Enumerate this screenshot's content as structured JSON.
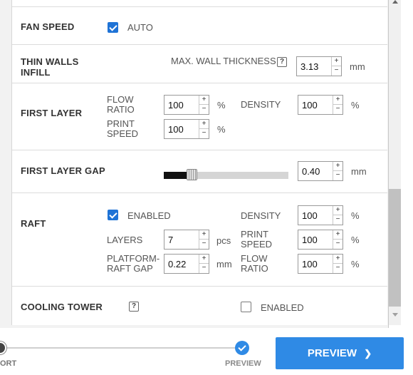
{
  "fan_speed": {
    "title": "FAN SPEED",
    "auto_label": "AUTO",
    "auto_checked": true
  },
  "thin_walls": {
    "title_line1": "THIN WALLS",
    "title_line2": "INFILL",
    "max_wall_label": "MAX. WALL THICKNESS",
    "help": "?",
    "value": "3.13",
    "unit": "mm"
  },
  "first_layer": {
    "title": "FIRST LAYER",
    "flow_label_1": "FLOW",
    "flow_label_2": "RATIO",
    "flow_value": "100",
    "flow_unit": "%",
    "speed_label_1": "PRINT",
    "speed_label_2": "SPEED",
    "speed_value": "100",
    "speed_unit": "%",
    "density_label": "DENSITY",
    "density_value": "100",
    "density_unit": "%"
  },
  "first_layer_gap": {
    "title": "FIRST LAYER GAP",
    "value": "0.40",
    "unit": "mm",
    "slider_fraction": 0.22
  },
  "raft": {
    "title": "RAFT",
    "enabled_label": "ENABLED",
    "enabled_checked": true,
    "layers_label": "LAYERS",
    "layers_value": "7",
    "layers_unit": "pcs",
    "gap_label_1": "PLATFORM-",
    "gap_label_2": "RAFT GAP",
    "gap_value": "0.22",
    "gap_unit": "mm",
    "density_label": "DENSITY",
    "density_value": "100",
    "density_unit": "%",
    "speed_label_1": "PRINT",
    "speed_label_2": "SPEED",
    "speed_value": "100",
    "speed_unit": "%",
    "flow_label_1": "FLOW",
    "flow_label_2": "RATIO",
    "flow_value": "100",
    "flow_unit": "%"
  },
  "cooling_tower": {
    "title": "COOLING TOWER",
    "help": "?",
    "enabled_label": "ENABLED",
    "enabled_checked": false
  },
  "stepper_plus": "+",
  "stepper_minus": "−",
  "footer": {
    "step_left_label": "ORT",
    "step_preview_label": "PREVIEW",
    "preview_button": "PREVIEW",
    "preview_chevron": "❯",
    "accent": "#2f8ae5"
  }
}
